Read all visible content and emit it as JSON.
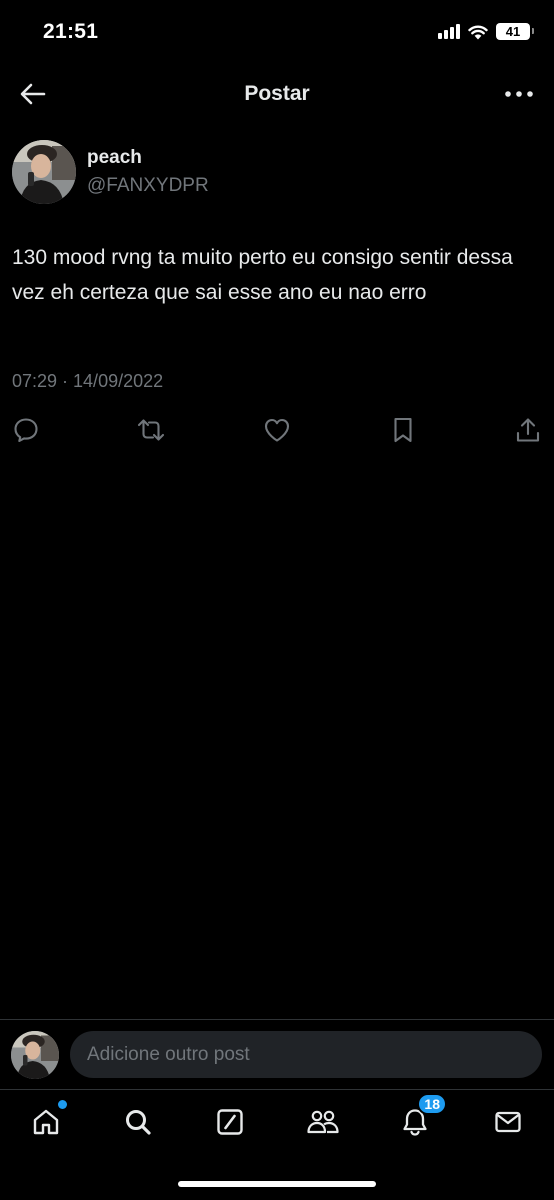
{
  "status_bar": {
    "time": "21:51",
    "battery": "41"
  },
  "header": {
    "title": "Postar"
  },
  "post": {
    "display_name": "peach",
    "handle": "@FANXYDPR",
    "text": "130 mood rvng ta muito perto eu consigo sentir dessa vez eh certeza que sai esse ano eu nao erro",
    "timestamp": "07:29 · 14/09/2022"
  },
  "actions": [
    "reply-icon",
    "repost-icon",
    "like-icon",
    "bookmark-icon",
    "share-icon"
  ],
  "reply": {
    "placeholder": "Adicione outro post"
  },
  "tabs": {
    "items": [
      "home",
      "search",
      "grok",
      "communities",
      "notifications",
      "messages"
    ],
    "notifications_count": "18"
  },
  "colors": {
    "accent": "#1d9bf0",
    "background": "#000000",
    "secondary_text": "#71767b"
  }
}
